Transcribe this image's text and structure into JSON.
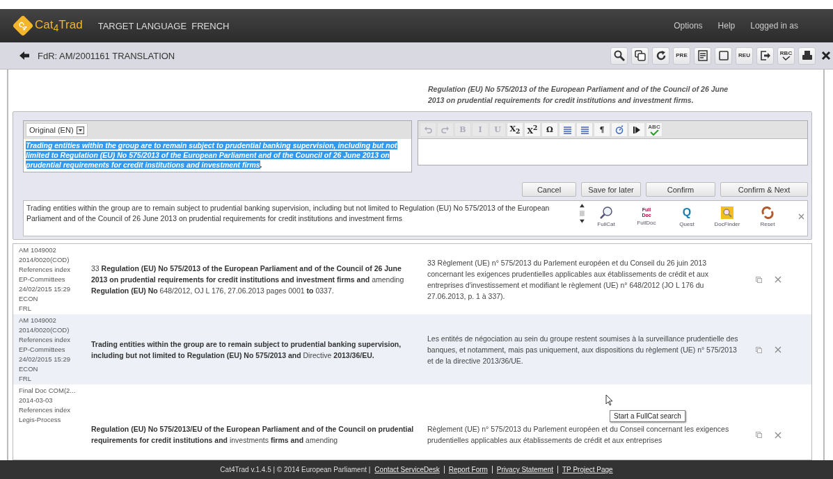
{
  "header": {
    "logo_badge": "C4",
    "logo": "Cat$_{4}$Trad",
    "title": "TARGET LANGUAGE  FRENCH",
    "menu": [
      "Options",
      "Help",
      "Logged in as"
    ]
  },
  "subbar": {
    "title": "FdR: AM/2001161 TRANSLATION",
    "tools": [
      {
        "kind": "search"
      },
      {
        "kind": "copy"
      },
      {
        "kind": "refresh"
      },
      {
        "kind": "label",
        "label": "PRE"
      },
      {
        "kind": "document"
      },
      {
        "kind": "square"
      },
      {
        "kind": "label",
        "label": "REU"
      },
      {
        "kind": "exit"
      },
      {
        "kind": "spell",
        "label": "RBC"
      },
      {
        "kind": "print"
      },
      {
        "kind": "close"
      }
    ]
  },
  "preview": "Regulation (EU) No 575/2013 of the European Parliament and of the Council of 26 June 2013 on prudential requirements for credit institutions and investment firms.",
  "source": {
    "language": "Original (EN)",
    "selected_text": "Trading entities within the group are to remain subject to prudential banking supervision, including but not limited to Regulation (EU) No 575/2013 of the European Parliament and of the Council of 26 June 2013 on prudential requirements for credit institutions and investment firms",
    "trailing": "."
  },
  "editor_tools": [
    {
      "kind": "undo",
      "disabled": true
    },
    {
      "kind": "redo",
      "disabled": true
    },
    {
      "kind": "text",
      "label": "B",
      "disabled": true
    },
    {
      "kind": "text",
      "label": "I",
      "disabled": true
    },
    {
      "kind": "text",
      "label": "U",
      "disabled": true
    },
    {
      "kind": "text",
      "label": "X$_{2}$",
      "disabled": false
    },
    {
      "kind": "text",
      "label": "X$^{2}$",
      "disabled": false
    },
    {
      "kind": "text",
      "label": "Ω",
      "disabled": false
    },
    {
      "kind": "list",
      "disabled": false
    },
    {
      "kind": "list",
      "disabled": false
    },
    {
      "kind": "text",
      "label": "¶",
      "disabled": false
    },
    {
      "kind": "timer",
      "disabled": false
    },
    {
      "kind": "arrow",
      "disabled": false
    },
    {
      "kind": "spell",
      "label": "ABC",
      "disabled": false
    }
  ],
  "actions": [
    "Cancel",
    "Save for later",
    "Confirm",
    "Confirm & Next"
  ],
  "concordance": {
    "text": "Trading entities within the group are to remain subject to prudential banking supervision, including but not limited to Regulation (EU) No 575/2013 of the European Parliament and of the Council of 26 June 2013 on prudential requirements for credit institutions and investment firms",
    "tools": [
      {
        "kind": "fullcat",
        "label": "FullCat"
      },
      {
        "kind": "fulldoc",
        "badge": "Full Doc",
        "label": "FullDoc"
      },
      {
        "kind": "quest",
        "badge": "Q",
        "label": "Quest"
      },
      {
        "kind": "docfinder",
        "label": "DocFinder"
      },
      {
        "kind": "reset",
        "label": "Reset"
      }
    ]
  },
  "results": [
    {
      "meta": [
        "AM 1049002",
        "2014/0020(COD)",
        "References index",
        "EP-Committees",
        "24/02/2015 15:29",
        "ECON",
        "FRL"
      ],
      "source": "33 **Regulation (EU) No 575/2013 of the European Parliament and of the Council of 26 June 2013 on prudential requirements for credit institutions and investment firms and** amending **Regulation (EU) No** 648/2012, OJ L 176, 27.06.2013 pages 0001 **to** 0337.",
      "target": "33 Règlement (UE) n° 575/2013 du Parlement européen et du Conseil du 26 juin 2013 concernant les exigences prudentielles applicables aux établissements de crédit et aux entreprises d'investissement et modifiant le règlement (UE) n° 648/2012 (JO L 176 du 27.06.2013, p. 1 à 337)."
    },
    {
      "meta": [
        "AM 1049002",
        "2014/0020(COD)",
        "References index",
        "EP-Committees",
        "24/02/2015 15:29",
        "ECON",
        "FRL"
      ],
      "source": "**Trading entities within the group are to remain subject to prudential banking supervision, including but not limited to Regulation (EU) No 575/2013 and** Directive **2013/36/EU.**",
      "target": "Les entités de négociation au sein du groupe restent soumises à la surveillance prudentielle des banques, et notamment, mais pas uniquement, aux dispositions du règlement (UE) n° 575/2013 et de la directive 2013/36/UE."
    },
    {
      "meta": [
        "Final Doc COM(2...",
        "2014-03-03",
        "References index",
        "Legis-Process"
      ],
      "source": "**Regulation (EU) No 575/2013/EU of the European Parliament and of the Council on prudential requirements for credit institutions and** investments **firms and** amending",
      "target": "Règlement (UE) n° 575/2013 du Parlement européen et du Conseil concernant les exigences prudentielles applicables aux établissements de crédit et aux entreprises"
    }
  ],
  "tooltip": "Start a FullCat search",
  "footer": {
    "text": "Cat4Trad v.1.4.5 | © 2014 European Parliament |",
    "links": [
      "Contact ServiceDesk",
      "Report Form",
      "Privacy Statement",
      "TP Project Page"
    ]
  }
}
